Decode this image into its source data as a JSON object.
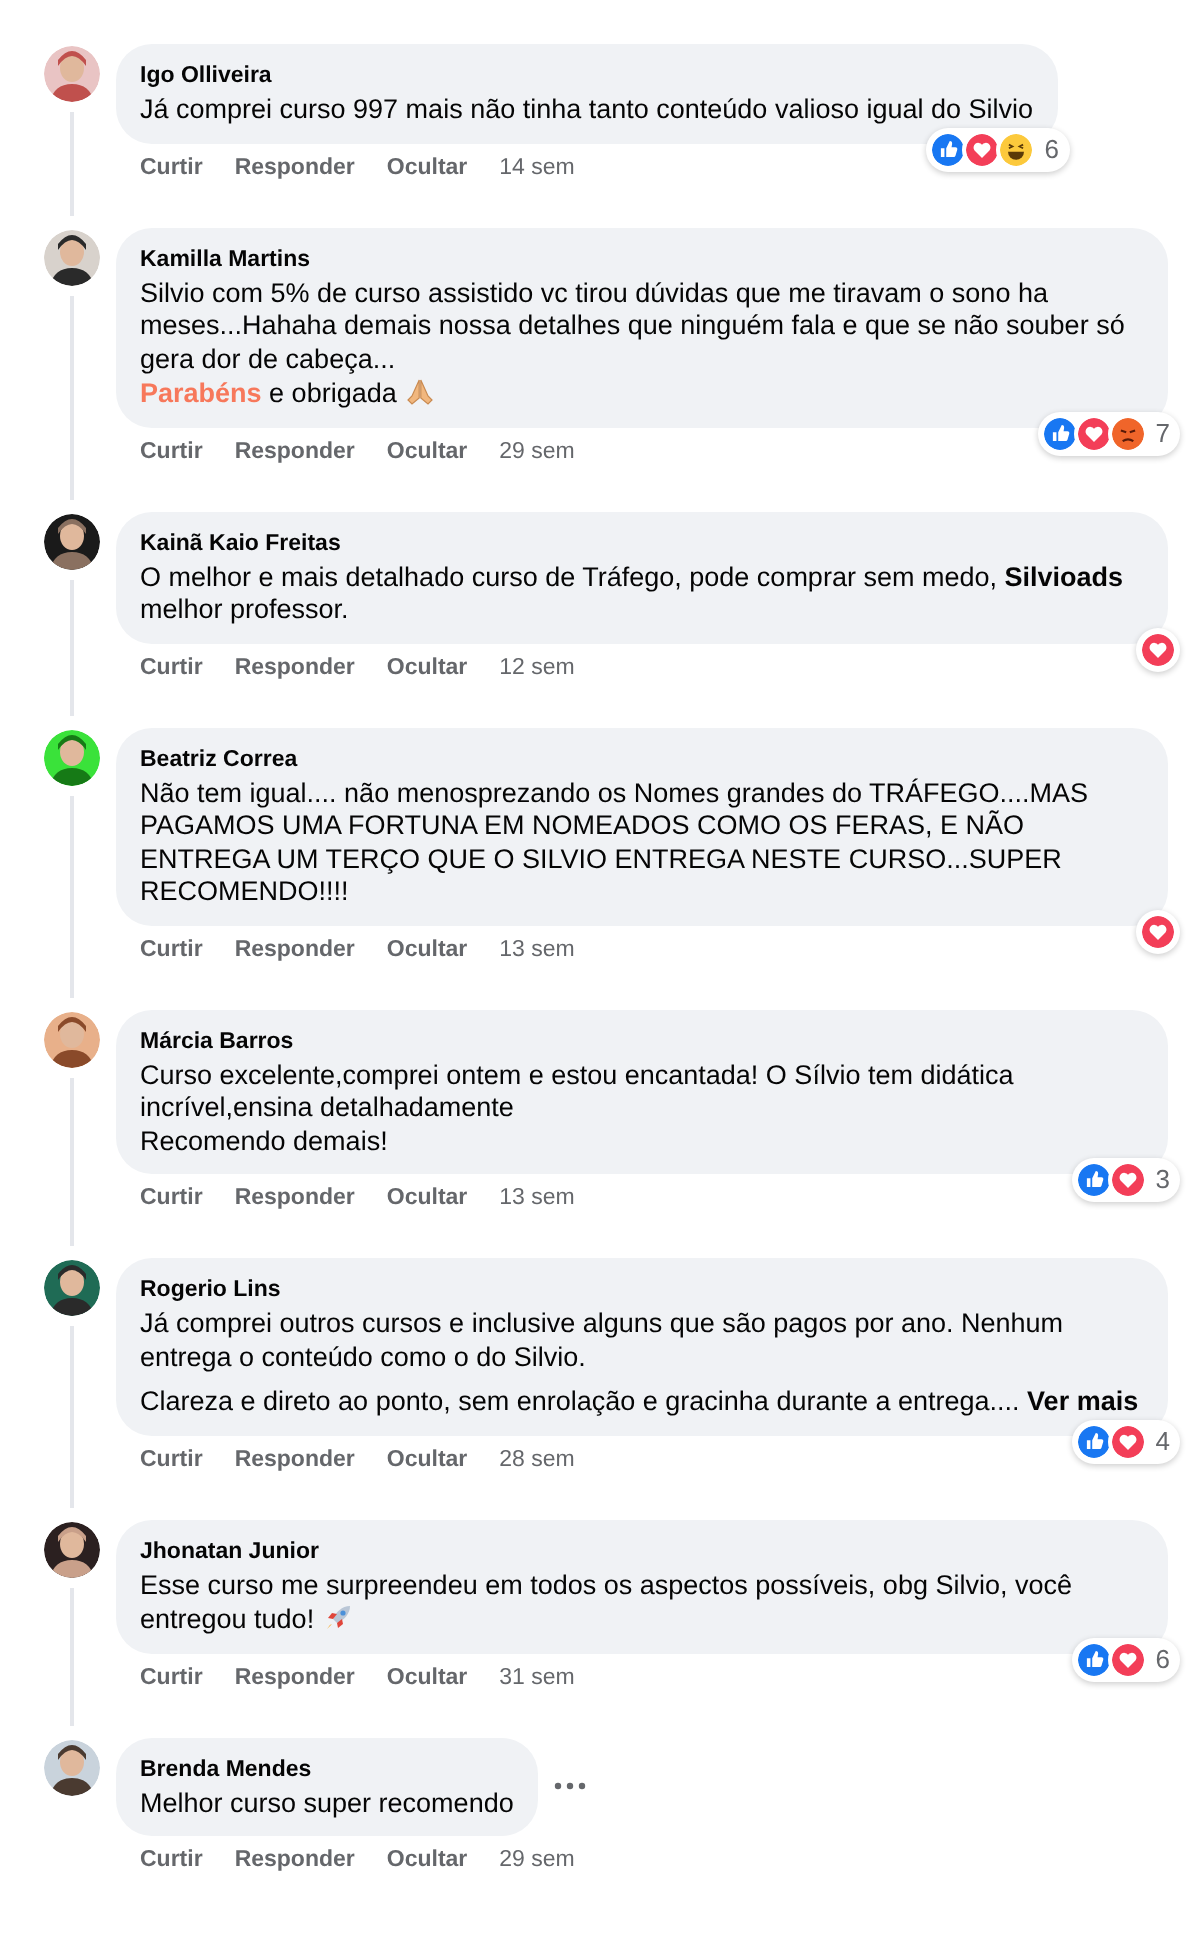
{
  "comments": [
    {
      "author": "Igo Olliveira",
      "avatar": {
        "kind": "picture"
      },
      "paragraphs": [
        {
          "text": "Já comprei curso 997 mais não tinha tanto conteúdo valioso igual do Silvio"
        }
      ],
      "reactions": [
        {
          "kind": "like"
        },
        {
          "kind": "love"
        },
        {
          "kind": "haha"
        }
      ],
      "reaction_count": "6",
      "actions": [
        "Curtir",
        "Responder",
        "Ocultar"
      ],
      "time": "14 sem"
    },
    {
      "author": "Kamilla Martins",
      "avatar": {
        "kind": "picture"
      },
      "paragraphs": [
        {
          "text": "Silvio com 5% de curso assistido vc tirou dúvidas que me tiravam o sono ha meses...Hahaha demais nossa detalhes que ninguém fala e que se não souber só gera dor de cabeça..."
        },
        {
          "text": "**Parabéns** e obrigada",
          "kind": "thanks"
        }
      ],
      "reactions": [
        {
          "kind": "like"
        },
        {
          "kind": "love"
        },
        {
          "kind": "angry"
        }
      ],
      "reaction_count": "7",
      "actions": [
        "Curtir",
        "Responder",
        "Ocultar"
      ],
      "time": "29 sem"
    },
    {
      "author": "Kainã Kaio Freitas",
      "avatar": {
        "kind": "picture"
      },
      "paragraphs": [
        {
          "text": "O melhor e mais detalhado curso de Tráfego, pode comprar sem medo, **Silvioads** melhor professor."
        }
      ],
      "reactions": [
        {
          "kind": "love"
        }
      ],
      "actions": [
        "Curtir",
        "Responder",
        "Ocultar"
      ],
      "time": "12 sem"
    },
    {
      "author": "Beatriz Correa",
      "avatar": {
        "kind": "picture"
      },
      "paragraphs": [
        {
          "text": "Não tem igual.... não menosprezando os Nomes grandes do TRÁFEGO....MAS PAGAMOS UMA FORTUNA EM NOMEADOS COMO OS FERAS, E NÃO ENTREGA UM TERÇO QUE O SILVIO ENTREGA NESTE CURSO...SUPER RECOMENDO!!!!"
        }
      ],
      "reactions": [
        {
          "kind": "love"
        }
      ],
      "actions": [
        "Curtir",
        "Responder",
        "Ocultar"
      ],
      "time": "13 sem"
    },
    {
      "author": "Márcia Barros",
      "avatar": {
        "kind": "picture"
      },
      "paragraphs": [
        {
          "text": "Curso excelente,comprei ontem e estou encantada! O Sílvio tem didática incrível,ensina detalhadamente"
        },
        {
          "text": "Recomendo demais!"
        }
      ],
      "reactions": [
        {
          "kind": "like"
        },
        {
          "kind": "love"
        }
      ],
      "reaction_count": "3",
      "actions": [
        "Curtir",
        "Responder",
        "Ocultar"
      ],
      "time": "13 sem"
    },
    {
      "author": "Rogerio Lins",
      "avatar": {
        "kind": "picture"
      },
      "paragraphs": [
        {
          "text": "Já comprei outros cursos e inclusive alguns que são pagos por ano. Nenhum entrega o conteúdo como o do Silvio."
        },
        {
          "text": "Clareza e direto ao ponto, sem enrolação e gracinha durante a entrega....",
          "spaced": true,
          "see_more": "Ver mais"
        }
      ],
      "reactions": [
        {
          "kind": "like"
        },
        {
          "kind": "love"
        }
      ],
      "reaction_count": "4",
      "actions": [
        "Curtir",
        "Responder",
        "Ocultar"
      ],
      "time": "28 sem"
    },
    {
      "author": "Jhonatan Junior",
      "avatar": {
        "kind": "picture"
      },
      "paragraphs": [
        {
          "text": "Esse curso me surpreendeu em todos os aspectos possíveis, obg Silvio, você entregou tudo!",
          "kind": "cheer"
        }
      ],
      "reactions": [
        {
          "kind": "like"
        },
        {
          "kind": "love"
        }
      ],
      "reaction_count": "6",
      "actions": [
        "Curtir",
        "Responder",
        "Ocultar"
      ],
      "time": "31 sem"
    },
    {
      "author": "Brenda Mendes",
      "avatar": {
        "kind": "picture"
      },
      "paragraphs": [
        {
          "text": "Melhor curso super recomendo"
        }
      ],
      "more_menu": true,
      "actions": [
        "Curtir",
        "Responder",
        "Ocultar"
      ],
      "time": "29 sem"
    }
  ]
}
